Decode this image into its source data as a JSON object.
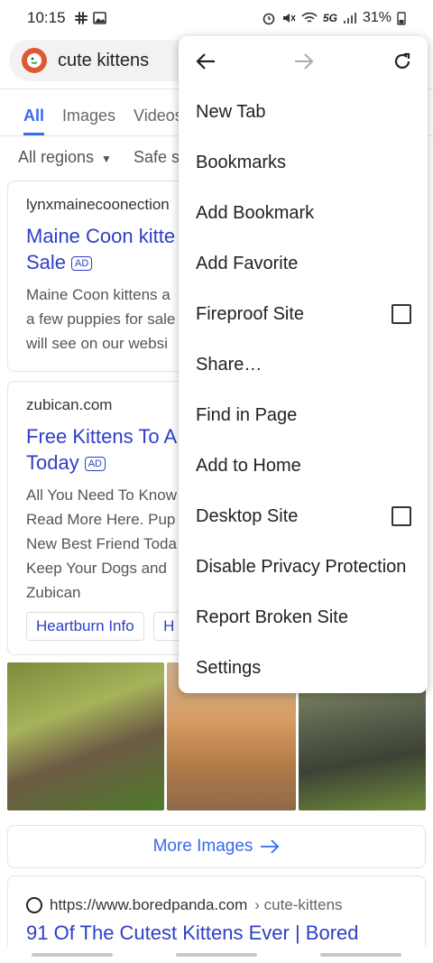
{
  "status_bar": {
    "time": "10:15",
    "network": "5G",
    "battery": "31%"
  },
  "search": {
    "query": "cute kittens",
    "logo_icon": "duckduckgo-logo"
  },
  "tabs": [
    "All",
    "Images",
    "Videos"
  ],
  "filters": {
    "region": "All regions",
    "safe_search": "Safe search"
  },
  "results": [
    {
      "domain": "lynxmainecoonection",
      "title_line1": "Maine Coon kitte",
      "title_line2": "Sale",
      "ad_badge": "AD",
      "snippet_lines": [
        "Maine Coon kittens a",
        "a few puppies for sale",
        "will see on our websi"
      ]
    },
    {
      "domain": "zubican.com",
      "title_line1": "Free Kittens To A",
      "title_line2": "Today",
      "ad_badge": "AD",
      "snippet_lines": [
        "All You Need To Know",
        "Read More Here. Pup",
        "New Best Friend Toda",
        "Keep Your Dogs and",
        "Zubican"
      ],
      "chips": [
        "Heartburn Info",
        "H"
      ]
    }
  ],
  "more_images": "More Images",
  "result3": {
    "url": "https://www.boredpanda.com",
    "path": "› cute-kittens",
    "title": "91 Of The Cutest Kittens Ever | Bored"
  },
  "menu": {
    "items": [
      {
        "label": "New Tab"
      },
      {
        "label": "Bookmarks"
      },
      {
        "label": "Add Bookmark"
      },
      {
        "label": "Add Favorite"
      },
      {
        "label": "Fireproof Site",
        "checkbox": false
      },
      {
        "label": "Share…"
      },
      {
        "label": "Find in Page"
      },
      {
        "label": "Add to Home"
      },
      {
        "label": "Desktop Site",
        "checkbox": false
      },
      {
        "label": "Disable Privacy Protection"
      },
      {
        "label": "Report Broken Site"
      },
      {
        "label": "Settings"
      }
    ]
  },
  "colors": {
    "accent": "#3969ef",
    "link": "#2d3fc7",
    "logo": "#de5833"
  }
}
